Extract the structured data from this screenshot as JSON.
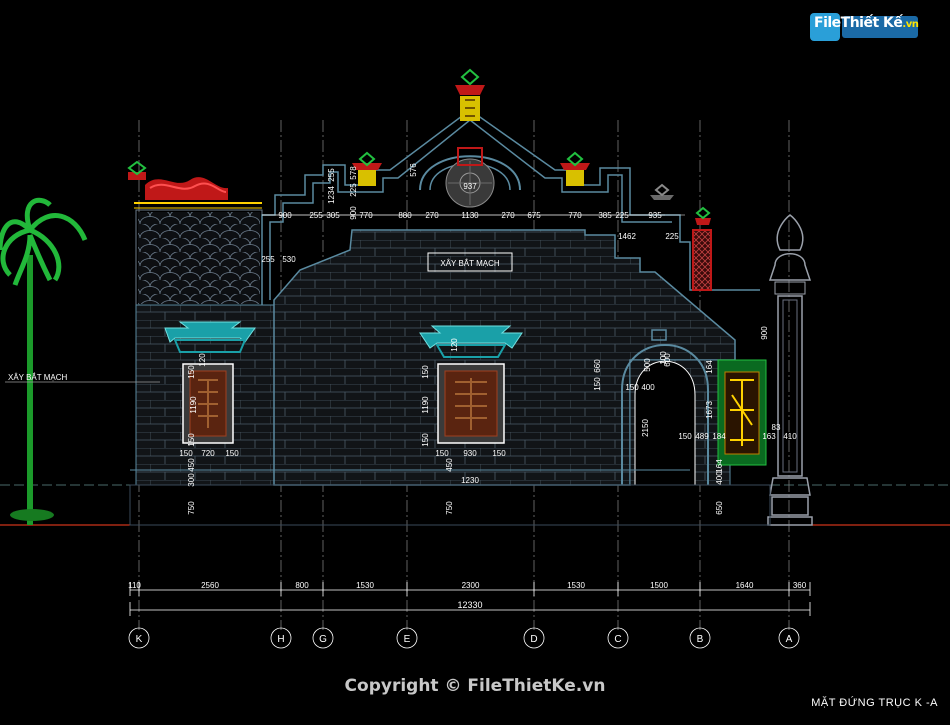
{
  "watermark": {
    "brand_main": "File",
    "brand_second": "Thiết Kế",
    "brand_suffix": ".vn"
  },
  "labels": {
    "wall_note_center": "XÂY BẮT MẠCH",
    "wall_note_left": "XÂY BẮT MẠCH"
  },
  "dims_total": {
    "overall": "12330"
  },
  "dims_bottom": [
    "110",
    "2560",
    "800",
    "1530",
    "2300",
    "1530",
    "1500",
    "1640",
    "360"
  ],
  "dims_top": [
    "900",
    "255",
    "305",
    "770",
    "880",
    "270",
    "1130",
    "270",
    "675",
    "770",
    "385",
    "225",
    "935"
  ],
  "dims_top_misc": [
    "1462",
    "225",
    "255",
    "530",
    "937"
  ],
  "dims_vertical": [
    "1234",
    "255",
    "578",
    "225",
    "900",
    "576"
  ],
  "dims_left_window": [
    "150",
    "720",
    "150",
    "1190",
    "120",
    "150",
    "150",
    "300",
    "450",
    "750"
  ],
  "dims_center_window": [
    "150",
    "930",
    "150",
    "1190",
    "120",
    "150",
    "150",
    "450",
    "750",
    "1230"
  ],
  "dims_door": [
    "150",
    "400",
    "500",
    "600",
    "100",
    "2150",
    "150",
    "660"
  ],
  "dims_right_column": [
    "150",
    "489",
    "184",
    "1673",
    "164",
    "83",
    "163",
    "410",
    "400",
    "164",
    "650",
    "900"
  ],
  "grid_axes": [
    "K",
    "H",
    "G",
    "E",
    "D",
    "C",
    "B",
    "A"
  ],
  "footer": {
    "copyright": "Copyright © FileThietKe.vn",
    "sheet_title": "MẶT ĐỨNG TRỤC K -A"
  }
}
